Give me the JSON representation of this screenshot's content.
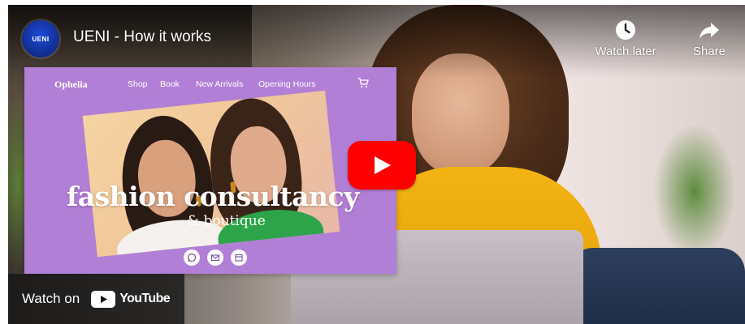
{
  "channel": {
    "avatar_text": "UENI"
  },
  "video": {
    "title": "UENI - How it works"
  },
  "actions": {
    "watch_later": {
      "label": "Watch later",
      "icon": "clock-icon"
    },
    "share": {
      "label": "Share",
      "icon": "share-arrow-icon"
    }
  },
  "website_preview": {
    "logo": "Ophelia",
    "nav": [
      "Shop",
      "Book",
      "New Arrivals",
      "Opening Hours"
    ],
    "hero_title": "fashion consultancy",
    "hero_subtitle": "& boutique",
    "contact_icons": [
      "whatsapp-icon",
      "mail-icon",
      "calendar-icon"
    ],
    "bg_color": "#b27fd6"
  },
  "play_button": {
    "icon": "play-icon",
    "color": "#ff0000"
  },
  "watch_on": {
    "label": "Watch on",
    "brand": "YouTube"
  }
}
